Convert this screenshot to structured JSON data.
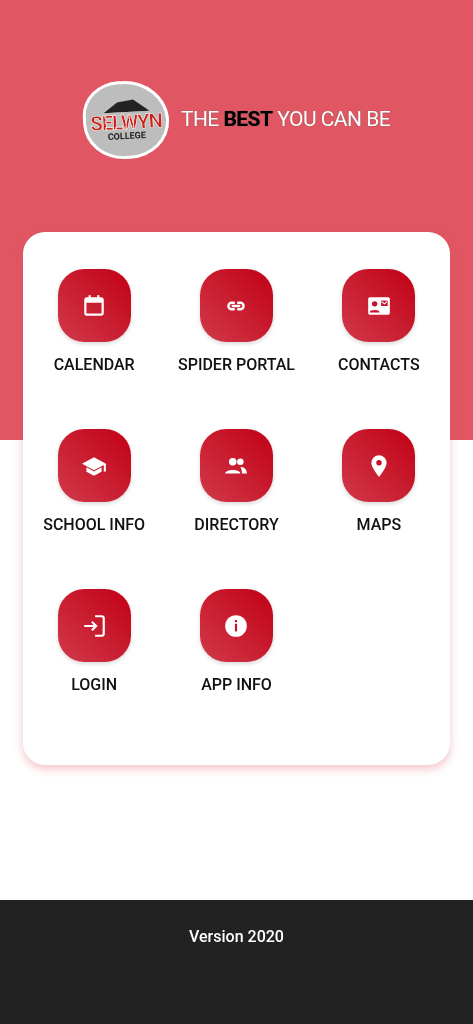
{
  "header": {
    "logo": {
      "name": "SELWYN",
      "subtitle": "COLLEGE"
    },
    "tagline": "THE **BEST** YOU CAN BE"
  },
  "menu": [
    {
      "label": "CALENDAR"
    },
    {
      "label": "SPIDER PORTAL"
    },
    {
      "label": "CONTACTS"
    },
    {
      "label": "SCHOOL INFO"
    },
    {
      "label": "DIRECTORY"
    },
    {
      "label": "MAPS"
    },
    {
      "label": "LOGIN"
    },
    {
      "label": "APP INFO"
    }
  ],
  "footer": {
    "version": "Version 2020"
  }
}
